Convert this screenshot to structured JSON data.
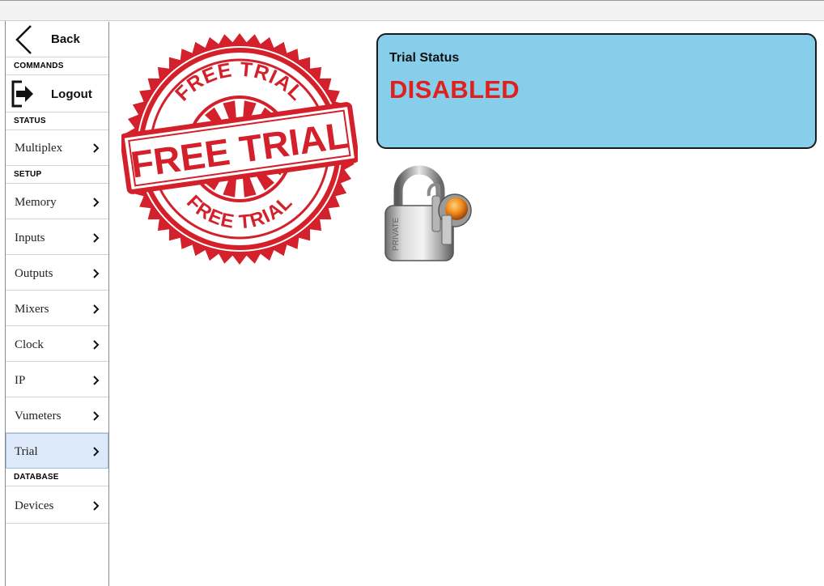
{
  "sidebar": {
    "back_label": "Back",
    "sections": {
      "commands": "COMMANDS",
      "status": "STATUS",
      "setup": "SETUP",
      "database": "DATABASE"
    },
    "logout_label": "Logout",
    "items": {
      "multiplex": "Multiplex",
      "memory": "Memory",
      "inputs": "Inputs",
      "outputs": "Outputs",
      "mixers": "Mixers",
      "clock": "Clock",
      "ip": "IP",
      "vumeters": "Vumeters",
      "trial": "Trial",
      "devices": "Devices"
    },
    "active_item": "Trial"
  },
  "stamp": {
    "top_text": "FREE TRIAL",
    "center_text": "FREE TRIAL",
    "bottom_text": "FREE TRIAL",
    "color": "#d4202a"
  },
  "status_panel": {
    "title": "Trial Status",
    "value": "DISABLED",
    "value_color": "#e0201d",
    "background": "#87ceeb"
  },
  "lock_icon": {
    "engraving": "PRIVATE"
  }
}
